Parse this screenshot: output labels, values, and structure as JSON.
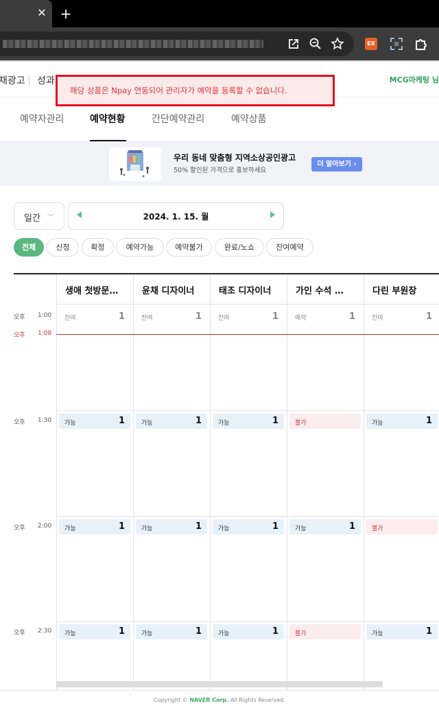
{
  "browser": {
    "close_tab": "✕",
    "new_tab": "+",
    "extension_badge": "EX"
  },
  "topnav": {
    "item1": "채광고",
    "item2": "성과",
    "user": "MCG마케팅 님"
  },
  "alert": {
    "message": "해당 상품은 Npay 연동되어 관리자가 예약을 등록할 수 없습니다."
  },
  "subtabs": [
    "예약자관리",
    "예약현황",
    "간단예약관리",
    "예약상품"
  ],
  "banner": {
    "title": "우리 동네 맞춤형 지역소상공인광고",
    "subtitle": "50% 할인된 가격으로 홍보하세요",
    "button": "더 알아보기 ›"
  },
  "controls": {
    "period": "일간",
    "date": "2024. 1. 15. 월"
  },
  "filters": [
    "전체",
    "신청",
    "확정",
    "예약가능",
    "예약불가",
    "완료/노쇼",
    "잔여예약"
  ],
  "schedule": {
    "columns": [
      "생애 첫방문…",
      "윤채 디자이너",
      "태조 디자이너",
      "가인 수석 …",
      "다린 부원장"
    ],
    "times": [
      {
        "ampm": "오후",
        "time": "1:00"
      },
      {
        "ampm": "오후",
        "time": "1:30"
      },
      {
        "ampm": "오후",
        "time": "2:00"
      },
      {
        "ampm": "오후",
        "time": "2:30"
      }
    ],
    "now": {
      "ampm": "오후",
      "time": "1:08"
    },
    "row1": [
      {
        "label": "잔여",
        "count": "1"
      },
      {
        "label": "잔여",
        "count": "1"
      },
      {
        "label": "잔여",
        "count": "1"
      },
      {
        "label": "예약",
        "count": "1"
      },
      {
        "label": "잔여",
        "count": "1"
      }
    ],
    "row2": [
      {
        "label": "가능",
        "count": "1",
        "status": "ok"
      },
      {
        "label": "가능",
        "count": "1",
        "status": "ok"
      },
      {
        "label": "가능",
        "count": "1",
        "status": "ok"
      },
      {
        "label": "불가",
        "count": "",
        "status": "no"
      },
      {
        "label": "가능",
        "count": "1",
        "status": "ok"
      }
    ],
    "row3": [
      {
        "label": "가능",
        "count": "1",
        "status": "ok"
      },
      {
        "label": "가능",
        "count": "1",
        "status": "ok"
      },
      {
        "label": "가능",
        "count": "1",
        "status": "ok"
      },
      {
        "label": "가능",
        "count": "1",
        "status": "ok"
      },
      {
        "label": "불가",
        "count": "",
        "status": "no"
      }
    ],
    "row4": [
      {
        "label": "가능",
        "count": "1",
        "status": "ok"
      },
      {
        "label": "가능",
        "count": "1",
        "status": "ok"
      },
      {
        "label": "가능",
        "count": "1",
        "status": "ok"
      },
      {
        "label": "불가",
        "count": "",
        "status": "no"
      },
      {
        "label": "가능",
        "count": "1",
        "status": "ok"
      }
    ]
  },
  "footer": {
    "prefix": "Copyright © ",
    "brand": "NAVER Corp.",
    "suffix": " All Rights Reserved."
  }
}
